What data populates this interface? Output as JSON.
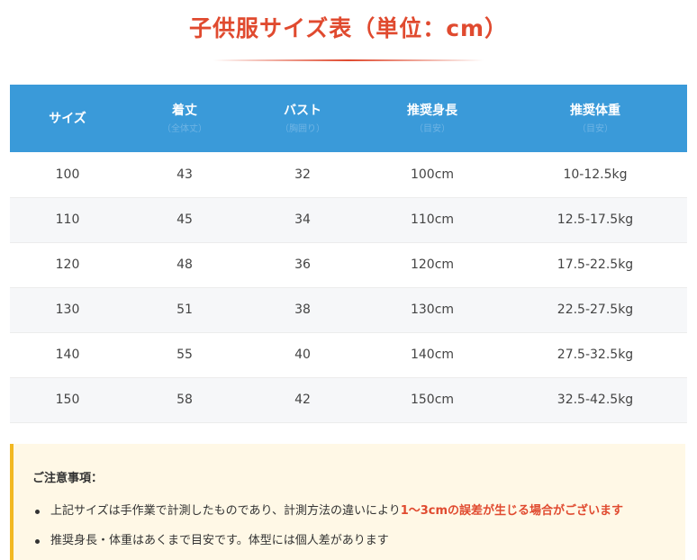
{
  "title": "子供服サイズ表（単位：cm）",
  "table": {
    "headers": [
      {
        "label": "サイズ",
        "sub": ""
      },
      {
        "label": "着丈",
        "sub": "（全体丈）"
      },
      {
        "label": "バスト",
        "sub": "（胸囲り）"
      },
      {
        "label": "推奨身長",
        "sub": "（目安）"
      },
      {
        "label": "推奨体重",
        "sub": "（目安）"
      }
    ],
    "rows": [
      [
        "100",
        "43",
        "32",
        "100cm",
        "10-12.5kg"
      ],
      [
        "110",
        "45",
        "34",
        "110cm",
        "12.5-17.5kg"
      ],
      [
        "120",
        "48",
        "36",
        "120cm",
        "17.5-22.5kg"
      ],
      [
        "130",
        "51",
        "38",
        "130cm",
        "22.5-27.5kg"
      ],
      [
        "140",
        "55",
        "40",
        "140cm",
        "27.5-32.5kg"
      ],
      [
        "150",
        "58",
        "42",
        "150cm",
        "32.5-42.5kg"
      ]
    ]
  },
  "notice": {
    "title": "ご注意事項：",
    "items": [
      {
        "text": "上記サイズは手作業で計測したものであり、計測方法の違いにより",
        "highlight": "1～3cmの誤差が生じる場合がございます"
      },
      {
        "text": "推奨身長・体重はあくまで目安です。体型には個人差があります",
        "highlight": ""
      }
    ]
  },
  "colors": {
    "accent": "#e04a2f",
    "header_bg": "#3a9ad9",
    "notice_bg": "#fff8e6",
    "notice_border": "#f2b822"
  }
}
